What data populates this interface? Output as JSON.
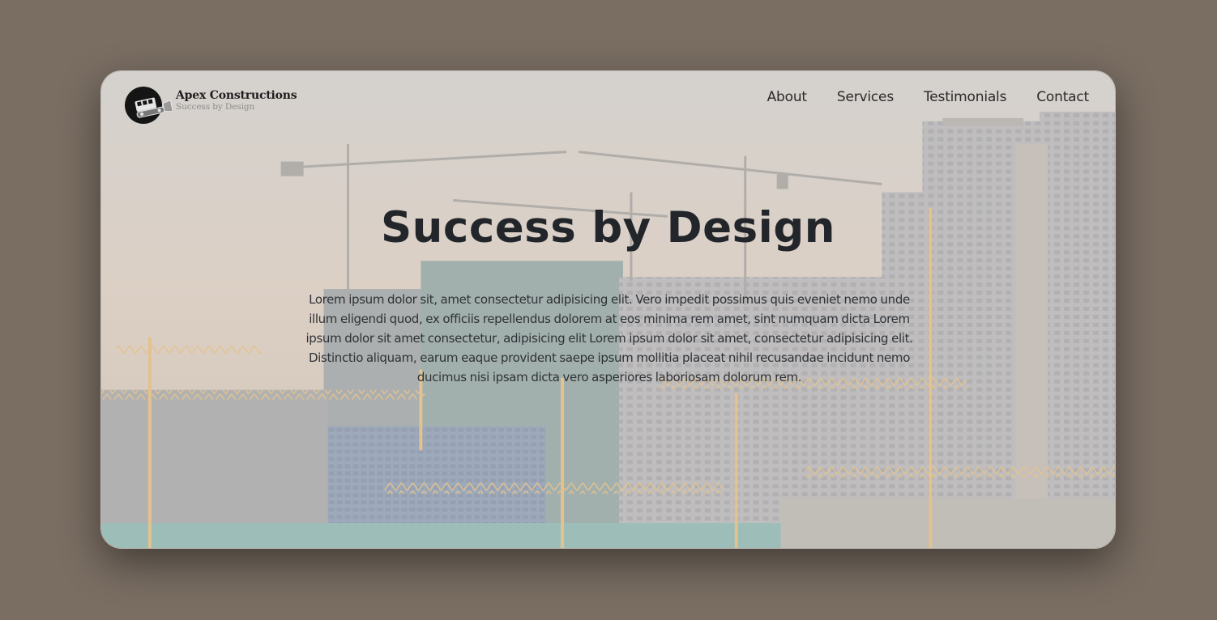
{
  "brand": {
    "name": "Apex Constructions",
    "tagline": "Success by Design"
  },
  "nav": {
    "items": [
      {
        "label": "About"
      },
      {
        "label": "Services"
      },
      {
        "label": "Testimonials"
      },
      {
        "label": "Contact"
      }
    ]
  },
  "hero": {
    "title": "Success by Design",
    "body": "Lorem ipsum dolor sit, amet consectetur adipisicing elit. Vero impedit possimus quis eveniet nemo unde illum eligendi quod, ex officiis repellendus dolorem at eos minima rem amet, sint numquam dicta Lorem ipsum dolor sit amet consectetur, adipisicing elit Lorem ipsum dolor sit amet, consectetur adipisicing elit. Distinctio aliquam, earum eaque provident saepe ipsum mollitia placeat nihil recusandae incidunt nemo ducimus nisi ipsam dicta vero asperiores laboriosam dolorum rem."
  },
  "colors": {
    "page_background": "#7a6e63",
    "text_dark": "#22262a",
    "crane_orange": "#e0a040"
  }
}
